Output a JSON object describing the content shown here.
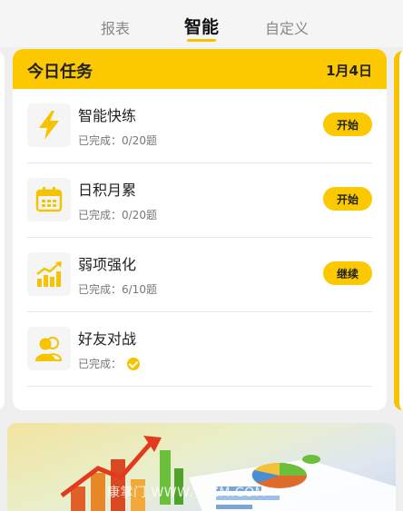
{
  "tabs": [
    {
      "label": "报表",
      "active": false
    },
    {
      "label": "智能",
      "active": true
    },
    {
      "label": "自定义",
      "active": false
    }
  ],
  "card": {
    "title": "今日任务",
    "date": "1月4日"
  },
  "tasks": [
    {
      "name": "智能快练",
      "progress": "已完成：0/20题",
      "button": "开始",
      "icon": "lightning-icon"
    },
    {
      "name": "日积月累",
      "progress": "已完成：0/20题",
      "button": "开始",
      "icon": "calendar-icon"
    },
    {
      "name": "弱项强化",
      "progress": "已完成：6/10题",
      "button": "继续",
      "icon": "growth-chart-icon"
    },
    {
      "name": "好友对战",
      "progress": "已完成：",
      "button": "",
      "icon": "friends-icon",
      "completed": true
    }
  ],
  "banner": {
    "watermark": "康掌门 WWW.YSZM.COM"
  },
  "colors": {
    "accent": "#fcc800",
    "background": "#efefef"
  }
}
